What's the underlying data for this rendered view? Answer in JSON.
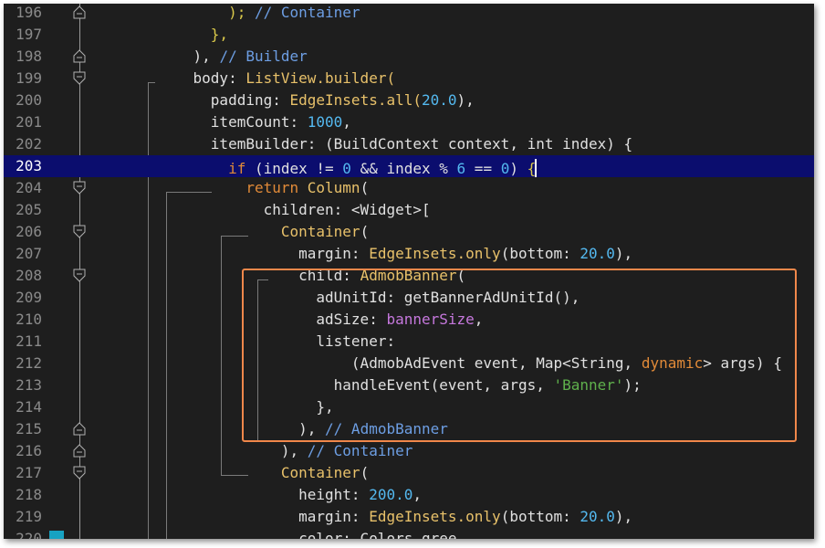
{
  "editor": {
    "active_line": "203",
    "lines": [
      {
        "n": "196",
        "indent": "        ",
        "tokens": [
          [
            "); ",
            "c-brace"
          ],
          [
            "// Container",
            "c-cmt"
          ]
        ]
      },
      {
        "n": "197",
        "indent": "      ",
        "tokens": [
          [
            "},",
            "c-brace"
          ]
        ]
      },
      {
        "n": "198",
        "indent": "    ",
        "tokens": [
          [
            "), ",
            "c-plain"
          ],
          [
            "// Builder",
            "c-cmt"
          ]
        ]
      },
      {
        "n": "199",
        "indent": "    ",
        "tokens": [
          [
            "body: ",
            "c-plain"
          ],
          [
            "ListView",
            "c-class"
          ],
          [
            ".builder(",
            "c-class"
          ]
        ]
      },
      {
        "n": "200",
        "indent": "      ",
        "tokens": [
          [
            "padding: ",
            "c-plain"
          ],
          [
            "EdgeInsets",
            "c-class"
          ],
          [
            ".all(",
            "c-class"
          ],
          [
            "20.0",
            "c-num"
          ],
          [
            "),",
            "c-plain"
          ]
        ]
      },
      {
        "n": "201",
        "indent": "      ",
        "tokens": [
          [
            "itemCount: ",
            "c-plain"
          ],
          [
            "1000",
            "c-num"
          ],
          [
            ",",
            "c-plain"
          ]
        ]
      },
      {
        "n": "202",
        "indent": "      ",
        "tokens": [
          [
            "itemBuilder: (BuildContext context, int index) {",
            "c-plain"
          ]
        ]
      },
      {
        "n": "203",
        "indent": "        ",
        "tokens": [
          [
            "if",
            "c-kw"
          ],
          [
            " (index != ",
            "c-plain"
          ],
          [
            "0",
            "c-num"
          ],
          [
            " && index % ",
            "c-plain"
          ],
          [
            "6",
            "c-num"
          ],
          [
            " == ",
            "c-plain"
          ],
          [
            "0",
            "c-num"
          ],
          [
            ") ",
            "c-plain"
          ],
          [
            "{",
            "c-brace"
          ]
        ]
      },
      {
        "n": "204",
        "indent": "          ",
        "tokens": [
          [
            "return ",
            "c-kw"
          ],
          [
            "Column",
            "c-class"
          ],
          [
            "(",
            "c-plain"
          ]
        ]
      },
      {
        "n": "205",
        "indent": "            ",
        "tokens": [
          [
            "children: <Widget>[",
            "c-plain"
          ]
        ]
      },
      {
        "n": "206",
        "indent": "              ",
        "tokens": [
          [
            "Container",
            "c-class"
          ],
          [
            "(",
            "c-plain"
          ]
        ]
      },
      {
        "n": "207",
        "indent": "                ",
        "tokens": [
          [
            "margin: ",
            "c-plain"
          ],
          [
            "EdgeInsets",
            "c-class"
          ],
          [
            ".only",
            "c-class"
          ],
          [
            "(bottom: ",
            "c-plain"
          ],
          [
            "20.0",
            "c-num"
          ],
          [
            "),",
            "c-plain"
          ]
        ]
      },
      {
        "n": "208",
        "indent": "                ",
        "tokens": [
          [
            "child: ",
            "c-plain"
          ],
          [
            "AdmobBanner",
            "c-class"
          ],
          [
            "(",
            "c-plain"
          ]
        ]
      },
      {
        "n": "209",
        "indent": "                  ",
        "tokens": [
          [
            "adUnitId: getBannerAdUnitId(),",
            "c-plain"
          ]
        ]
      },
      {
        "n": "210",
        "indent": "                  ",
        "tokens": [
          [
            "adSize: ",
            "c-plain"
          ],
          [
            "bannerSize",
            "c-var"
          ],
          [
            ",",
            "c-plain"
          ]
        ]
      },
      {
        "n": "211",
        "indent": "                  ",
        "tokens": [
          [
            "listener:",
            "c-plain"
          ]
        ]
      },
      {
        "n": "212",
        "indent": "                      ",
        "tokens": [
          [
            "(AdmobAdEvent event, Map<String, ",
            "c-plain"
          ],
          [
            "dynamic",
            "c-kw"
          ],
          [
            "> args) {",
            "c-plain"
          ]
        ]
      },
      {
        "n": "213",
        "indent": "                    ",
        "tokens": [
          [
            "handleEvent(event, args, ",
            "c-plain"
          ],
          [
            "'Banner'",
            "c-str"
          ],
          [
            ");",
            "c-plain"
          ]
        ]
      },
      {
        "n": "214",
        "indent": "                  ",
        "tokens": [
          [
            "},",
            "c-plain"
          ]
        ]
      },
      {
        "n": "215",
        "indent": "                ",
        "tokens": [
          [
            "), ",
            "c-plain"
          ],
          [
            "// AdmobBanner",
            "c-cmt"
          ]
        ]
      },
      {
        "n": "216",
        "indent": "              ",
        "tokens": [
          [
            "), ",
            "c-plain"
          ],
          [
            "// Container",
            "c-cmt"
          ]
        ]
      },
      {
        "n": "217",
        "indent": "              ",
        "tokens": [
          [
            "Container",
            "c-class"
          ],
          [
            "(",
            "c-plain"
          ]
        ]
      },
      {
        "n": "218",
        "indent": "                ",
        "tokens": [
          [
            "height: ",
            "c-plain"
          ],
          [
            "200.0",
            "c-num"
          ],
          [
            ",",
            "c-plain"
          ]
        ]
      },
      {
        "n": "219",
        "indent": "                ",
        "tokens": [
          [
            "margin: ",
            "c-plain"
          ],
          [
            "EdgeInsets",
            "c-class"
          ],
          [
            ".only",
            "c-class"
          ],
          [
            "(bottom: ",
            "c-plain"
          ],
          [
            "20.0",
            "c-num"
          ],
          [
            "),",
            "c-plain"
          ]
        ]
      },
      {
        "n": "220",
        "indent": "                ",
        "tokens": [
          [
            "color: Colors.gree",
            "c-plain"
          ]
        ]
      }
    ]
  },
  "colors": {
    "background": "#1e1e1e",
    "active_line_bg": "#0b0d6e",
    "highlight_border": "#f0874a",
    "class": "#e8c16a",
    "keyword": "#e18a38",
    "number": "#54b9f0",
    "comment": "#6d9ee3",
    "string": "#5fb04c"
  }
}
